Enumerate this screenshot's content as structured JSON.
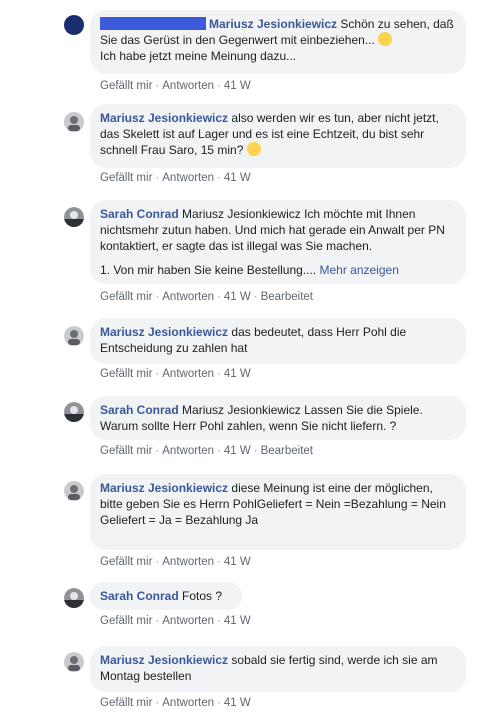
{
  "labels": {
    "like": "Gefällt mir",
    "reply": "Antworten",
    "edited": "Bearbeitet",
    "more": "Mehr anzeigen"
  },
  "comments": [
    {
      "author": "Mariusz Jesionkiewicz",
      "text": "Schön zu sehen, daß Sie das Gerüst in den Gegenwert mit einbeziehen...",
      "text2": "Ich habe jetzt meine Meinung dazu...",
      "time": "41 W"
    },
    {
      "author": "Mariusz Jesionkiewicz",
      "text": "also werden wir es tun, aber nicht jetzt, das Skelett ist auf Lager und es ist eine Echtzeit, du bist sehr schnell Frau Saro, 15 min?",
      "time": "41 W"
    },
    {
      "author": "Sarah Conrad",
      "text": "Mariusz Jesionkiewicz Ich möchte mit Ihnen nichtsmehr zutun haben. Und mich hat gerade ein Anwalt per PN kontaktiert, er sagte das ist illegal was Sie machen.",
      "text2": "1. Von mir haben Sie keine Bestellung....",
      "time": "41 W"
    },
    {
      "author": "Mariusz Jesionkiewicz",
      "text": "das bedeutet, dass Herr Pohl die Entscheidung zu zahlen hat",
      "time": "41 W"
    },
    {
      "author": "Sarah Conrad",
      "text": "Mariusz Jesionkiewicz Lassen Sie die Spiele. Warum sollte Herr Pohl zahlen, wenn Sie nicht liefern. ?",
      "time": "41 W"
    },
    {
      "author": "Mariusz Jesionkiewicz",
      "text": "diese Meinung ist eine der möglichen, bitte geben Sie es Herrn PohlGeliefert = Nein =Bezahlung = Nein",
      "text2": "Geliefert = Ja = Bezahlung Ja",
      "time": "41 W"
    },
    {
      "author": "Sarah Conrad",
      "text": "Fotos ?",
      "time": "41 W"
    },
    {
      "author": "Mariusz Jesionkiewicz",
      "text": "sobald sie fertig sind, werde ich sie am Montag bestellen",
      "time": "41 W"
    }
  ]
}
